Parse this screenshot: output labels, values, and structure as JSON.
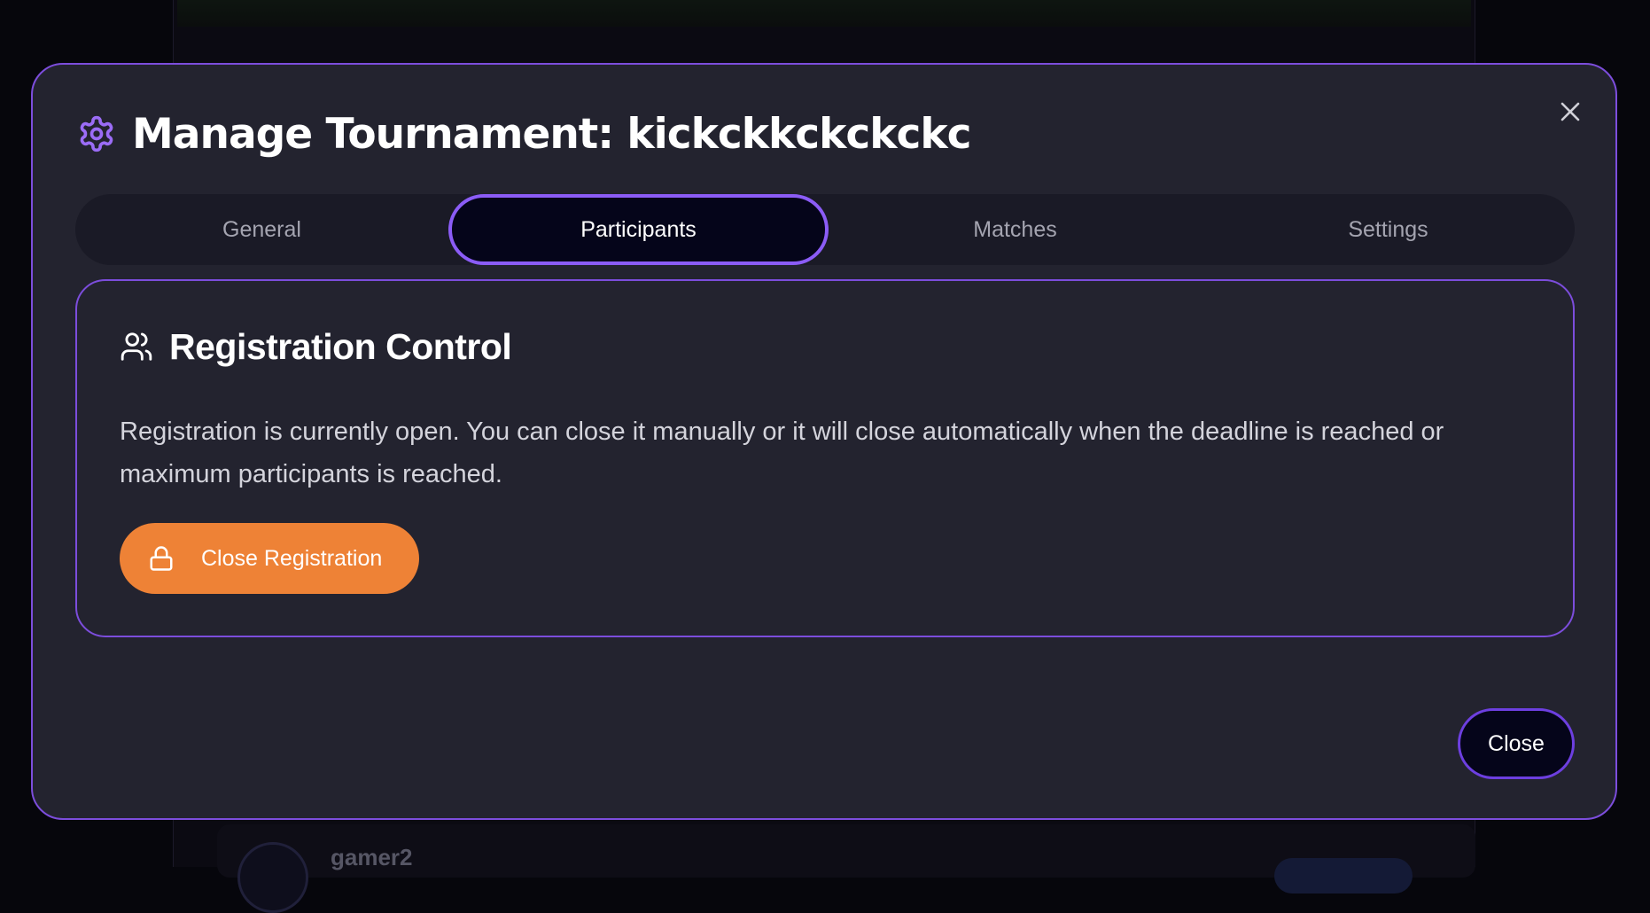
{
  "modal": {
    "title": "Manage Tournament: kickckkckckckc",
    "title_icon": "gear-icon",
    "close_icon": "close-icon"
  },
  "tabs": [
    {
      "label": "General",
      "active": false
    },
    {
      "label": "Participants",
      "active": true
    },
    {
      "label": "Matches",
      "active": false
    },
    {
      "label": "Settings",
      "active": false
    }
  ],
  "registration": {
    "icon": "users-icon",
    "title": "Registration Control",
    "description": "Registration is currently open. You can close it manually or it will close automatically when the deadline is reached or maximum participants is reached.",
    "button_label": "Close Registration",
    "button_icon": "lock-icon"
  },
  "footer": {
    "close_label": "Close"
  },
  "background": {
    "participant_name": "gamer2"
  },
  "colors": {
    "accent": "#8b5cf6",
    "modal_bg": "#23232f",
    "orange_button": "#ee8236"
  }
}
